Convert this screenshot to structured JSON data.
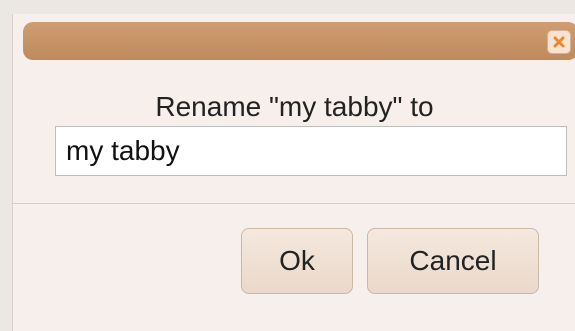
{
  "dialog": {
    "prompt": "Rename \"my tabby\" to",
    "input_value": "my tabby",
    "ok_label": "Ok",
    "cancel_label": "Cancel",
    "close_icon": "close-icon"
  },
  "colors": {
    "titlebar": "#c9956a",
    "dialog_bg": "#f6efec",
    "close_x": "#e8892f"
  }
}
